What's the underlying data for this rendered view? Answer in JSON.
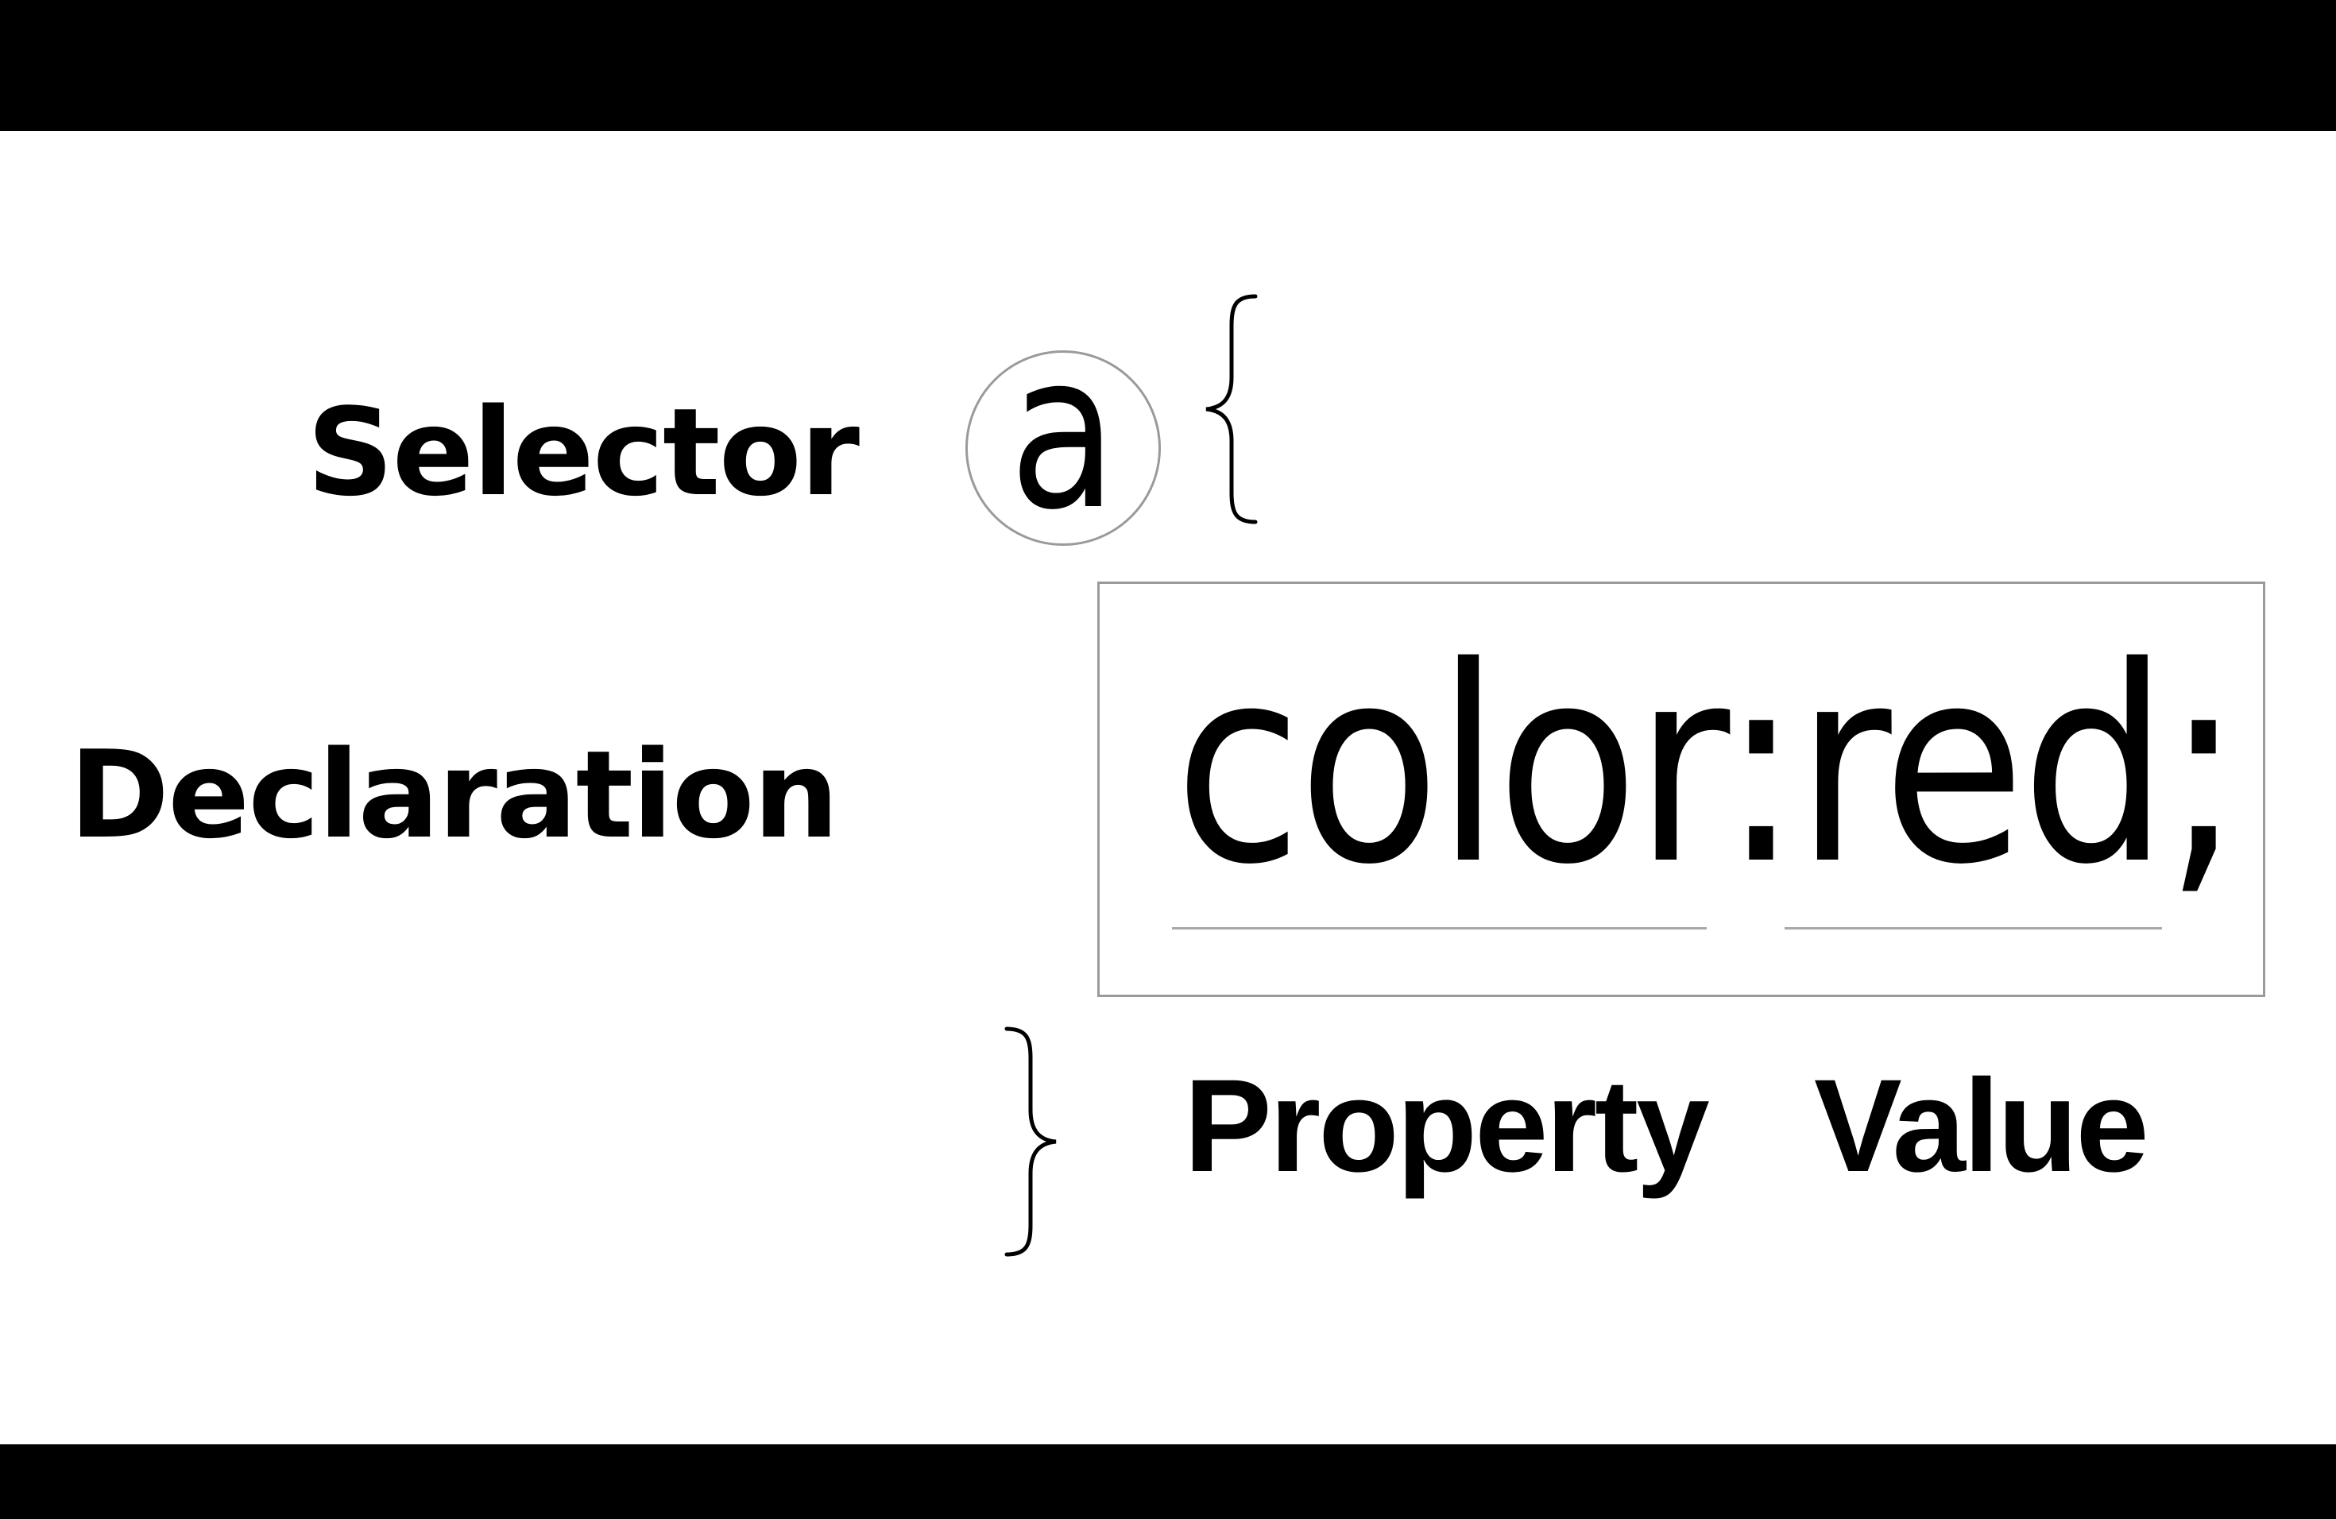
{
  "labels": {
    "selector": "Selector",
    "declaration": "Declaration",
    "property": "Property",
    "value": "Value"
  },
  "code": {
    "selector": "a",
    "declaration": "color:red;"
  },
  "colors": {
    "background": "#ffffff",
    "letterbox": "#000000",
    "text": "#000000",
    "outline": "#9a9a9a"
  }
}
